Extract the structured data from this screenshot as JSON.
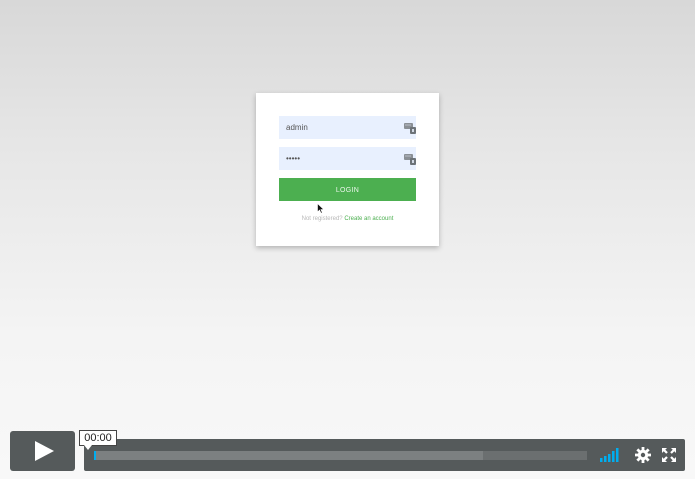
{
  "login_form": {
    "username_value": "admin",
    "password_value": "•••••",
    "login_label": "LOGIN",
    "register_prompt": "Not registered?",
    "register_link": "Create an account"
  },
  "video_player": {
    "current_time": "00:00",
    "progress_fraction": 0.003,
    "buffered_fraction": 0.79,
    "colors": {
      "bar": "#555a5b",
      "accent": "#00adef",
      "login_button": "#4caf50"
    }
  },
  "icons": {
    "username_key": "key-icon",
    "password_key": "key-icon",
    "cursor": "mouse-pointer-icon",
    "play": "play-icon",
    "volume": "volume-icon",
    "settings": "gear-icon",
    "fullscreen": "fullscreen-icon"
  }
}
